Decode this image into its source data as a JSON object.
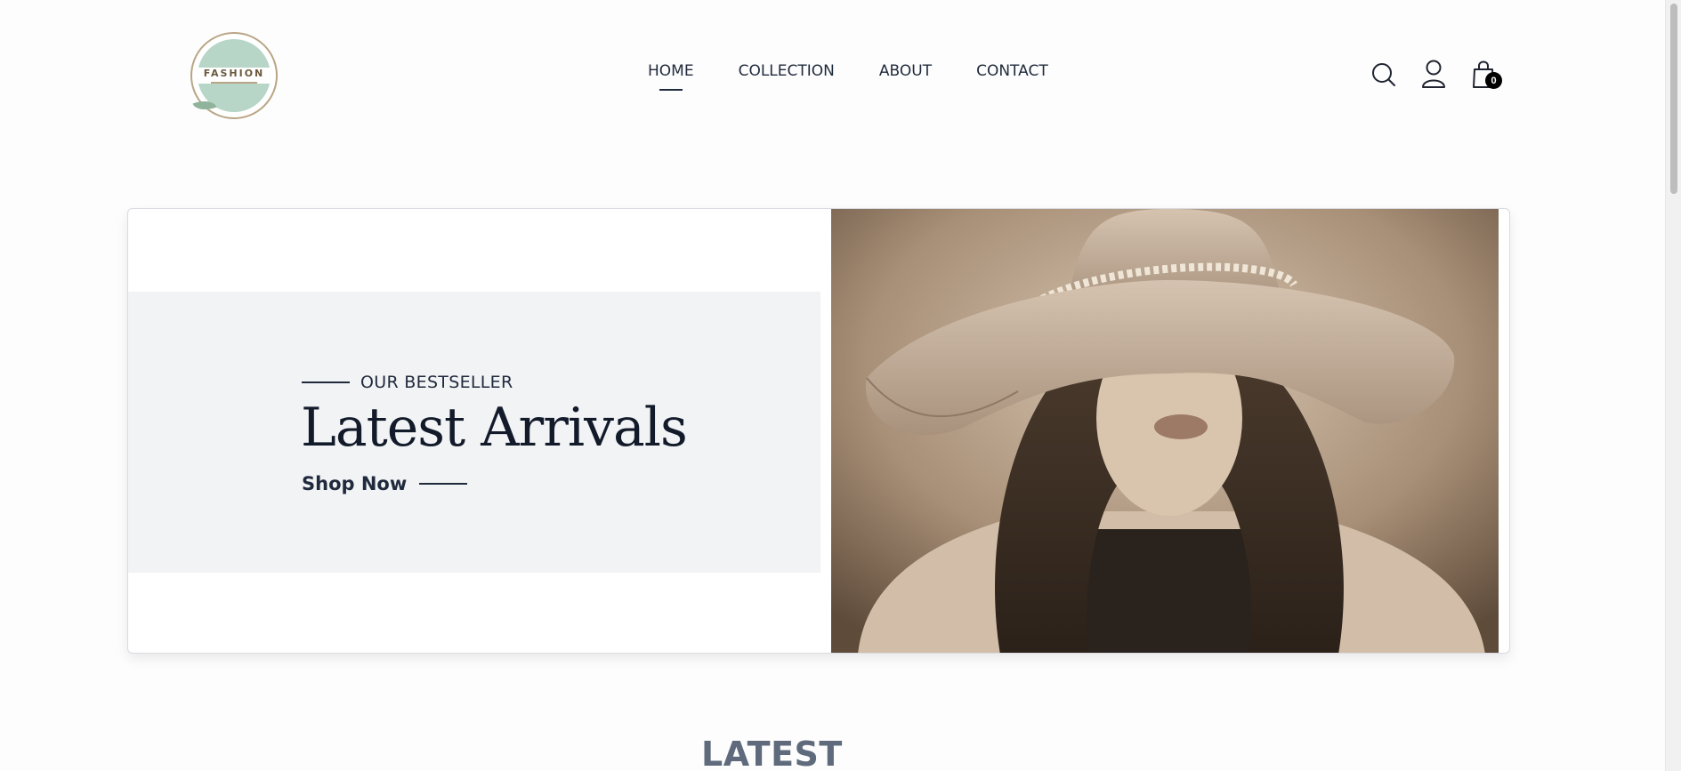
{
  "brand": {
    "logo_text": "FASHION",
    "logo_alt": "Fashion logo"
  },
  "nav": {
    "items": [
      {
        "label": "HOME",
        "active": true
      },
      {
        "label": "COLLECTION",
        "active": false
      },
      {
        "label": "ABOUT",
        "active": false
      },
      {
        "label": "CONTACT",
        "active": false
      }
    ]
  },
  "header_icons": {
    "search": "search-icon",
    "account": "user-icon",
    "cart": "shopping-bag-icon",
    "cart_count": "0"
  },
  "hero": {
    "eyebrow": "OUR BESTSELLER",
    "title": "Latest Arrivals",
    "cta": "Shop Now",
    "image_alt": "Woman in a wide-brimmed felt hat with a chain band, sepia tone"
  },
  "section": {
    "title": "LATEST"
  },
  "colors": {
    "text_dark": "#1f2a3c",
    "panel_bg": "#f2f3f5",
    "logo_green": "#b7d6c8",
    "logo_gold": "#b9a585"
  }
}
